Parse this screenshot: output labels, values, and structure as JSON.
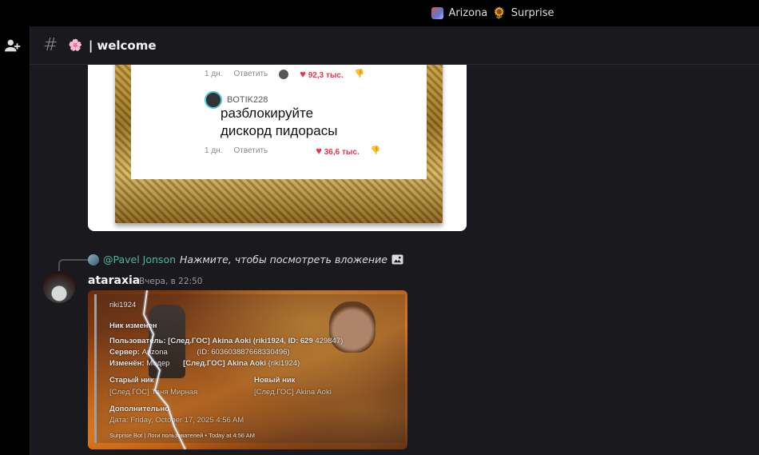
{
  "titlebar": {
    "server_name": "Arizona",
    "server_suffix": "Surprise"
  },
  "channel": {
    "name": "welcome",
    "separator": "|"
  },
  "meme": {
    "row1": {
      "time": "1 дн.",
      "reply": "Ответить",
      "likes": "92,3 тыс."
    },
    "user": "BOTIK228",
    "comment_line1": "разблокируйте",
    "comment_line2": "дискорд пидорасы",
    "row2": {
      "time": "1 дн.",
      "reply": "Ответить",
      "likes": "36,6 тыс."
    }
  },
  "message": {
    "reply_to": "@Pavel Jonson",
    "reply_text": "Нажмите, чтобы посмотреть вложение",
    "author": "ataraxia",
    "timestamp": "Вчера, в 22:50"
  },
  "embed": {
    "author": "riki1924",
    "title": "Ник изменен",
    "user_label": "Пользователь:",
    "user_value": "[След.ГОС] Akina Aoki (riki1924, ID: 629",
    "user_value_tail": "429847)",
    "server_label": "Сервер:",
    "server_value": "Arizona",
    "server_id": "(ID: 603603887668330496)",
    "changed_label": "Изменён:",
    "changed_value": "Модер",
    "changed_target": "[След.ГОС] Akina Aoki",
    "changed_user": "(riki1924)",
    "old_label": "Старый ник",
    "old_value": "[След.ГОС] Таня Мирная",
    "new_label": "Новый ник",
    "new_value": "[След.ГОС] Akina Aoki",
    "extra_label": "Дополнительно",
    "date_label": "Дата:",
    "date_value": "Friday, October 17, 2025 4:56 AM",
    "footer": "Surprise Bot | Логи пользователей • Today at 4:56 AM"
  },
  "colors": {
    "reply_name": "#4fb3a0",
    "likes": "#e8344e",
    "frame": "#c9a24a"
  }
}
